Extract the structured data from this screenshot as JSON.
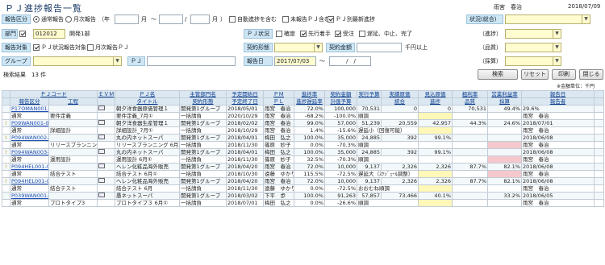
{
  "title": "ＰＪ進捗報告一覧",
  "user": "雨宮　春治",
  "date": "2018/07/09",
  "filters": {
    "report_kubun_label": "報告区分",
    "opt_normal": "通常報告",
    "opt_monthly": "月次報告",
    "year_label": "（年",
    "month_label": "月",
    "slash": "/",
    "close_paren": "）",
    "auto_progress": "自動進捗を含む",
    "unreported": "未報告ＰＪ含む",
    "pj_latest": "ＰＪ別最新進捗",
    "status_total_label": "状況(総合)",
    "dept_label": "部門",
    "dept_code": "012",
    "dept_name": "開発1部",
    "pj_status_label": "ＰＪ状況",
    "st_kakudo": "確度",
    "st_senko": "先行着手",
    "st_juchu": "受注",
    "st_enki": "遅延、中止、完了",
    "shinchoku_label": "（進捗）",
    "report_target_label": "報告対象",
    "pj_status_report": "ＰＪ状況報告対象",
    "monthly_pj": "月次報告ＰＪ",
    "contract_form_label": "契約形態",
    "contract_amount_label": "契約金額",
    "amount_unit": "千円以上",
    "quality_label": "（品質）",
    "group_label": "グループ",
    "pj_label": "ＰＪ",
    "report_date_label": "報告日",
    "report_date_from": "2017/07/03",
    "tilde": "〜",
    "date_blank": "/　/",
    "profit_label": "（採算）",
    "result_text": "検索結果　13 件",
    "search_btn": "検索",
    "reset_btn": "リセット",
    "print_btn": "印刷",
    "close_btn": "閉じる",
    "unit_note": "※金額単位：千円"
  },
  "headers": {
    "row1": [
      "",
      "ＰＪコード",
      "",
      "ＥＶＭ",
      "ＰＪ名",
      "",
      "主管部門名",
      "予定開始日",
      "ＰＭ",
      "進捗率",
      "契約金額",
      "実行予算",
      "実績原価",
      "見込原価",
      "粗利率",
      "営業利益率",
      "報告日",
      ""
    ],
    "row2": [
      "",
      "報告区分",
      "工程",
      "",
      "タイトル",
      "",
      "契約形態",
      "予定終了日",
      "ＰＬ",
      "進捗遅延率",
      "計画予算",
      "",
      "統合",
      "進捗",
      "品質",
      "採算",
      "報告者",
      ""
    ]
  },
  "rows": [
    {
      "c": [
        "",
        "P17OMAN001-00",
        "",
        "",
        "朝夕洋食器原価管理１",
        "",
        "開発第1グループ",
        "2018/05/01",
        "雨宮　春治",
        "72.0%",
        "100,000",
        "70,531",
        "0",
        "",
        "0",
        "70,531",
        "49.4%",
        "29.6%",
        "2018/07/01",
        ""
      ],
      "marks": []
    },
    {
      "c": [
        "",
        "通常",
        "要件定義",
        "",
        "要件定義_7月①",
        "",
        "一括請負",
        "2020/10/29",
        "雨宮　春治",
        "-68.2%",
        "-100.0%",
        "順調",
        "",
        "",
        "",
        "",
        "",
        "",
        "雨宮　春治",
        ""
      ]
    },
    {
      "c": [
        "!",
        "P09WAN001-00",
        "",
        "",
        "朝夕洋食器生産管理１",
        "",
        "開発第1グループ",
        "2018/02/02",
        "雨宮　春治",
        "99.0%",
        "57,000",
        "51,239",
        "20,559",
        "",
        "42,957",
        "44.3%",
        "24.6%",
        "2018/07/01",
        ""
      ]
    },
    {
      "c": [
        "",
        "通常",
        "詳細設計",
        "",
        "詳細設計_7月①",
        "",
        "一括請負",
        "2018/10/29",
        "雨宮　春治",
        "1.4%",
        "-15.6%",
        "遅延小（回復可能）",
        "",
        "",
        "",
        "",
        "",
        "",
        "雨宮　春治",
        ""
      ]
    },
    {
      "c": [
        "!",
        "P094WAN002-00",
        "",
        "",
        "丸の内ネットスーパ",
        "",
        "開発第1グループ",
        "2018/04/01",
        "梅田　弘之",
        "100.0%",
        "35,000",
        "24,885",
        "392",
        "",
        "99.1%",
        "",
        "",
        "2018/06/08",
        ""
      ]
    },
    {
      "c": [
        "",
        "通常",
        "リリースプランニング",
        "",
        "リリースプランニング 6月",
        "",
        "一括請負",
        "2018/11/30",
        "篠原　妙子",
        "0.0%",
        "-70.3%",
        "順調",
        "",
        "",
        "",
        "",
        "",
        "",
        "雨宮　春治",
        ""
      ]
    },
    {
      "c": [
        "!",
        "P094WAN003-00",
        "",
        "",
        "丸の内ネットスーパ",
        "",
        "開発第1グループ",
        "2018/04/01",
        "梅田　弘之",
        "100.0%",
        "35,000",
        "24,885",
        "392",
        "",
        "99.1%",
        "",
        "",
        "2018/06/08",
        ""
      ]
    },
    {
      "c": [
        "",
        "通常",
        "運用設計",
        "",
        "運用設計 6月①",
        "",
        "一括請負",
        "2018/11/30",
        "篠原　妙子",
        "32.5%",
        "-70.3%",
        "順調",
        "",
        "",
        "",
        "",
        "",
        "",
        "雨宮　春治",
        ""
      ]
    },
    {
      "c": [
        "!",
        "P094HEL001-00",
        "",
        "",
        "ヘレン化粧品海外販売",
        "",
        "開発第1グループ",
        "2018/04/20",
        "雨宮　春治",
        "72.0%",
        "10,000",
        "9,137",
        "2,326",
        "",
        "2,326",
        "87.7%",
        "82.1%",
        "2018/06/08",
        ""
      ]
    },
    {
      "c": [
        "",
        "通常",
        "結合テスト",
        "",
        "結合テスト 6月①",
        "",
        "一括請負",
        "2018/10/30",
        "遠藤　ゆかり",
        "115.5%",
        "-72.5%",
        "遅延大（ｽｹｼﾞｭｰﾙ調整）",
        "",
        "",
        "",
        "",
        "",
        "",
        "雨宮　春治",
        ""
      ]
    },
    {
      "c": [
        "!",
        "P094HEL001-00",
        "",
        "",
        "ヘレン化粧品海外販売",
        "",
        "開発第1グループ",
        "2018/04/20",
        "雨宮　春治",
        "72.0%",
        "10,000",
        "9,137",
        "2,326",
        "",
        "2,326",
        "87.7%",
        "82.1%",
        "2018/06/08",
        ""
      ]
    },
    {
      "c": [
        "",
        "通常",
        "結合テスト",
        "",
        "結合テスト 6月",
        "",
        "一括請負",
        "2018/11/30",
        "遠藤　ゆかり",
        "0.0%",
        "-72.5%",
        "おおむね順調",
        "",
        "",
        "",
        "",
        "",
        "",
        "雨宮　春治",
        ""
      ]
    },
    {
      "c": [
        "",
        "P039WAN001-00",
        "",
        "",
        "愚ネットスーパ",
        "",
        "開発第1グループ",
        "2018/03/02",
        "下平　歩",
        "100.0%",
        "91,263",
        "57,857",
        "73,466",
        "",
        "40.1%",
        "",
        "33.2%",
        "2018/06/05",
        ""
      ]
    },
    {
      "c": [
        "",
        "通常",
        "プロトタイプ3",
        "",
        "プロトタイプ３ 6月①",
        "",
        "一括請負",
        "2018/07/01",
        "梅田　弘之",
        "0.0%",
        "-26.6%",
        "順調",
        "",
        "",
        "",
        "",
        "",
        "",
        "雨宮　春治",
        ""
      ]
    }
  ]
}
